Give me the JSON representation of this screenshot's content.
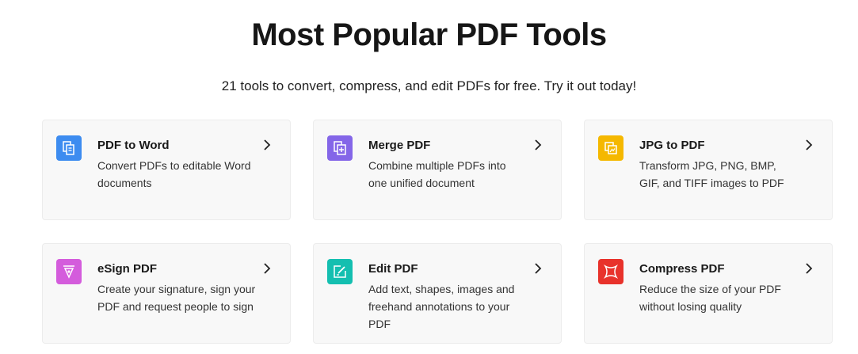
{
  "header": {
    "title": "Most Popular PDF Tools",
    "subtitle": "21 tools to convert, compress, and edit PDFs for free. Try it out today!"
  },
  "tools": [
    {
      "name": "PDF to Word",
      "desc": "Convert PDFs to editable Word documents",
      "icon": "word-doc-icon",
      "color": "#3d8cf0"
    },
    {
      "name": "Merge PDF",
      "desc": "Combine multiple PDFs into one unified document",
      "icon": "merge-icon",
      "color": "#8466e8"
    },
    {
      "name": "JPG to PDF",
      "desc": "Transform JPG, PNG, BMP, GIF, and TIFF images to PDF",
      "icon": "image-convert-icon",
      "color": "#f5b800"
    },
    {
      "name": "eSign PDF",
      "desc": "Create your signature, sign your PDF and request people to sign",
      "icon": "pen-nib-icon",
      "color": "#d45cdc"
    },
    {
      "name": "Edit PDF",
      "desc": "Add text, shapes, images and freehand annotations to your PDF",
      "icon": "edit-icon",
      "color": "#14bfb0"
    },
    {
      "name": "Compress PDF",
      "desc": "Reduce the size of your PDF without losing quality",
      "icon": "compress-icon",
      "color": "#e8322b"
    }
  ]
}
